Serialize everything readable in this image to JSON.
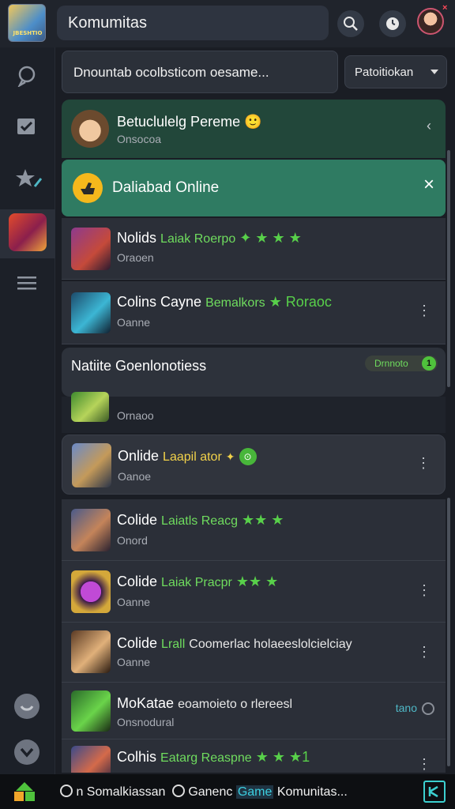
{
  "header": {
    "title": "Komumitas",
    "search_icon": "search-icon",
    "notify_icon": "clock-icon",
    "avatar_badge": "×"
  },
  "logo": {
    "text": "JBESHTIO"
  },
  "filter": {
    "search_text": "Dnountab ocolbsticom oesame...",
    "dropdown_label": "Patoitiokan"
  },
  "pinned": {
    "title": "Betuclulelg Pereme",
    "emoji": "🙂",
    "subtitle": "Onsocoa",
    "chevron": "‹"
  },
  "online_banner": {
    "label": "Daliabad Online",
    "close": "×"
  },
  "rows_top": [
    {
      "name": "Nolids",
      "tag": "Laiak Roerpo",
      "stars": "✦ ★ ★ ★",
      "subtitle": "Oraoen"
    },
    {
      "name": "Colins  Cayne",
      "tag": "Bemalkors",
      "stars": "★ Roraoc",
      "subtitle": "Oanne",
      "menu": "⋮"
    }
  ],
  "section": {
    "title": "Natiite Goenlonotiess",
    "pill_label": "Drnnoto",
    "pill_count": "1"
  },
  "partial_row": {
    "subtitle": "Ornaoo"
  },
  "highlight_row": {
    "name": "Onlide",
    "tag": "Laapil ator",
    "emoji": "✦",
    "badge": "⊙",
    "subtitle": "Oanoe",
    "menu": "⋮"
  },
  "rows_bottom": [
    {
      "name": "Colide",
      "tag": "Laiatls Reacg",
      "stars": "★★ ★",
      "subtitle": "Onord"
    },
    {
      "name": "Colide",
      "tag": "Laiak Pracpr",
      "stars": "★★ ★",
      "subtitle": "Oanne",
      "menu": "⋮"
    },
    {
      "name": "Colide",
      "tag": "Lrall",
      "extra": "Coomerlac holaeeslolcielciay",
      "subtitle": "Oanne",
      "menu": "⋮"
    },
    {
      "name": "MoKatae",
      "tag": "",
      "extra": "eoamoieto o rlereesl",
      "subtitle": "Onsnodural",
      "presence": "tano"
    },
    {
      "name": "Colhis",
      "tag": "Eatarg Reaspne",
      "stars": "★ ★ ★1",
      "subtitle": "",
      "menu": "⋮"
    }
  ],
  "taskbar": {
    "segment1": "n Somalkiassan",
    "segment2": "Ganenc",
    "highlight": "Game",
    "segment3": "Komunitas..."
  },
  "colors": {
    "accent_green": "#6fdc5e",
    "pinned_bg": "#22473a",
    "banner_bg": "#2f7b62",
    "app_bg": "#1a1d24"
  }
}
